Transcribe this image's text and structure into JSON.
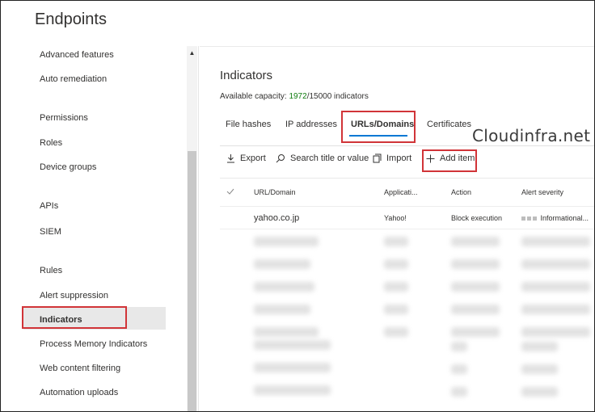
{
  "page": {
    "title": "Endpoints"
  },
  "sidebar": {
    "items": [
      {
        "label": "Advanced features",
        "type": "item"
      },
      {
        "label": "Auto remediation",
        "type": "item"
      },
      {
        "label": "Permissions",
        "type": "heading"
      },
      {
        "label": "Roles",
        "type": "item"
      },
      {
        "label": "Device groups",
        "type": "item"
      },
      {
        "label": "APIs",
        "type": "heading"
      },
      {
        "label": "SIEM",
        "type": "item"
      },
      {
        "label": "Rules",
        "type": "heading"
      },
      {
        "label": "Alert suppression",
        "type": "item"
      },
      {
        "label": "Indicators",
        "type": "item",
        "selected": true
      },
      {
        "label": "Process Memory Indicators",
        "type": "item"
      },
      {
        "label": "Web content filtering",
        "type": "item"
      },
      {
        "label": "Automation uploads",
        "type": "item"
      }
    ]
  },
  "main": {
    "title": "Indicators",
    "capacity": {
      "label": "Available capacity:",
      "used": "1972",
      "total_text": "/15000 indicators"
    },
    "tabs": [
      {
        "label": "File hashes"
      },
      {
        "label": "IP addresses"
      },
      {
        "label": "URLs/Domains",
        "active": true
      },
      {
        "label": "Certificates"
      }
    ],
    "toolbar": {
      "export": "Export",
      "search": "Search title or value",
      "import": "Import",
      "add_item": "Add item"
    },
    "table": {
      "columns": [
        "URL/Domain",
        "Applicati...",
        "Action",
        "Alert severity"
      ],
      "rows": [
        {
          "url": "yahoo.co.jp",
          "app": "Yahoo!",
          "action": "Block execution",
          "severity": "Informational..."
        }
      ]
    }
  },
  "watermark": "Cloudinfra.net",
  "colors": {
    "accent": "#0078d4",
    "highlight": "#d13438",
    "capacity_green": "#107c10"
  }
}
